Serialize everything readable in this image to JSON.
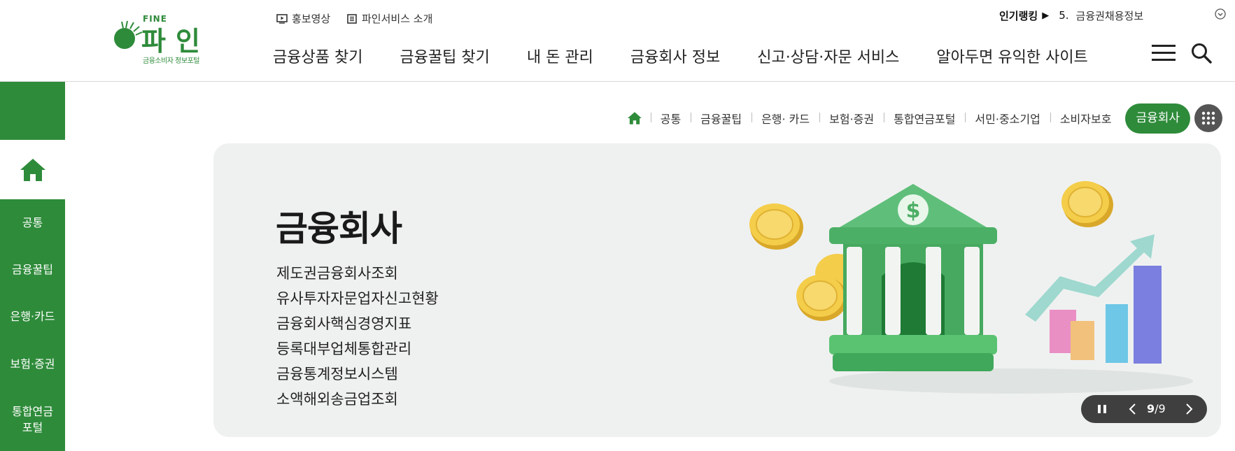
{
  "logo": {
    "fine": "FINE",
    "name": "파인",
    "subtitle": "금융소비자 정보포털"
  },
  "utility": [
    {
      "label": "홍보영상",
      "icon": "play-icon"
    },
    {
      "label": "파인서비스 소개",
      "icon": "list-icon"
    }
  ],
  "gnb": [
    "금융상품 찾기",
    "금융꿀팁 찾기",
    "내 돈 관리",
    "금융회사 정보",
    "신고·상담·자문 서비스",
    "알아두면 유익한 사이트"
  ],
  "ranking": {
    "label": "인기랭킹",
    "number": "5.",
    "text": "금융권채용정보"
  },
  "sidebar": {
    "items": [
      "공통",
      "금융꿀팁",
      "은행·카드",
      "보험·증권",
      "통합연금\n포털"
    ]
  },
  "breadcrumbs": {
    "items": [
      "공통",
      "금융꿀팁",
      "은행· 카드",
      "보험·증권",
      "통합연금포털",
      "서민·중소기업",
      "소비자보호"
    ],
    "active": "금융회사"
  },
  "banner": {
    "title": "금융회사",
    "links": [
      "제도권금융회사조회",
      "유사투자자문업자신고현황",
      "금융회사핵심경영지표",
      "등록대부업체통합관리",
      "금융통계정보시스템",
      "소액해외송금업조회"
    ],
    "current_slide": "9",
    "separator": "/",
    "total_slides": "9"
  },
  "colors": {
    "brand": "#2e8b3a",
    "banner_bg": "#eff1f0",
    "control_bg": "#3f3f3f"
  }
}
